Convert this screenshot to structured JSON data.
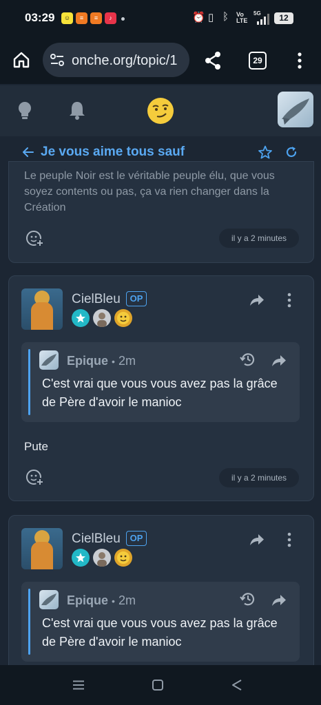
{
  "status_bar": {
    "time": "03:29",
    "battery": "12",
    "network": "5G",
    "volte": "Vo LTE"
  },
  "browser": {
    "url": "onche.org/topic/1",
    "tab_count": "29"
  },
  "topic": {
    "title": "Je vous aime tous sauf"
  },
  "post_prev": {
    "text": "Le peuple Noir est le véritable peuple élu, que vous soyez contents ou pas, ça va rien changer dans la Création",
    "time": "il y a 2 minutes"
  },
  "post1": {
    "author": "CielBleu",
    "op_label": "OP",
    "quote_author": "Epique",
    "quote_sep": "•",
    "quote_time": "2m",
    "quote_text": "C'est vrai que vous vous avez pas la grâce de Père d'avoir le manioc",
    "body": "Pute",
    "time": "il y a 2 minutes"
  },
  "post2": {
    "author": "CielBleu",
    "op_label": "OP",
    "quote_author": "Epique",
    "quote_sep": "•",
    "quote_time": "2m",
    "quote_text": "C'est vrai que vous vous avez pas la grâce de Père d'avoir le manioc"
  },
  "colors": {
    "accent": "#4da3f0",
    "title": "#5aa9f2",
    "background": "#1c2633",
    "card": "#253140"
  }
}
